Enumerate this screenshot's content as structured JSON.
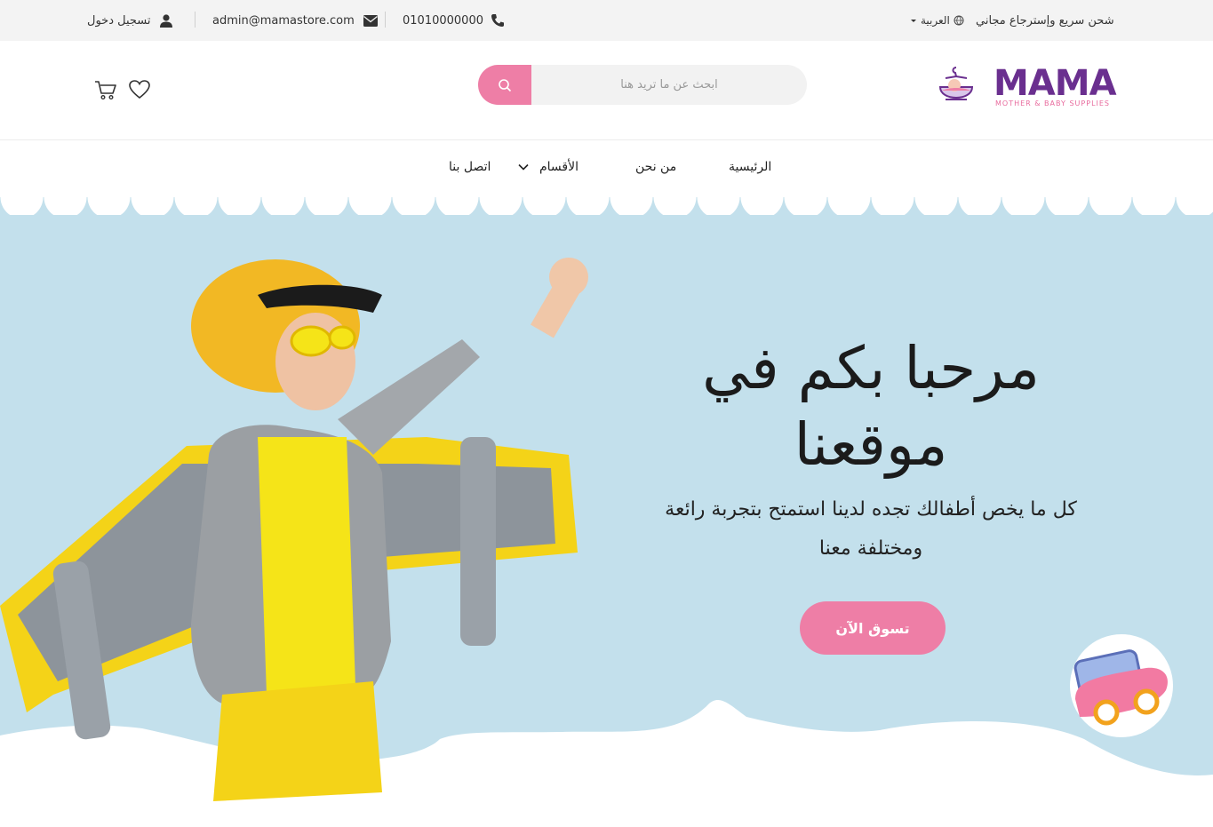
{
  "topbar": {
    "shipping": "شحن سريع وإسترجاع مجاني",
    "language": "العربية",
    "phone": "01010000000",
    "email": "admin@mamastore.com",
    "login": "تسجيل دخول"
  },
  "header": {
    "logo_title": "MAMA",
    "logo_subtitle": "MOTHER & BABY SUPPLIES",
    "search_placeholder": "ابحث عن ما تريد هنا"
  },
  "nav": {
    "home": "الرئيسية",
    "about": "من نحن",
    "categories": "الأقسام",
    "contact": "اتصل بنا"
  },
  "hero": {
    "title_line1": "مرحبا بكم في",
    "title_line2": "موقعنا",
    "subtitle_line1": "كل ما يخص أطفالك تجده لدينا استمتح بتجربة رائعة",
    "subtitle_line2": "ومختلفة معنا",
    "cta": "تسوق الآن"
  },
  "colors": {
    "accent_pink": "#ee7ea6",
    "brand_purple": "#6a2f8f",
    "hero_blue": "#c3e0ec",
    "topbar_bg": "#f3f3f3"
  },
  "icons": [
    "globe-icon",
    "chevron-down-icon",
    "phone-icon",
    "envelope-icon",
    "user-icon",
    "search-icon",
    "heart-icon",
    "cart-icon"
  ]
}
